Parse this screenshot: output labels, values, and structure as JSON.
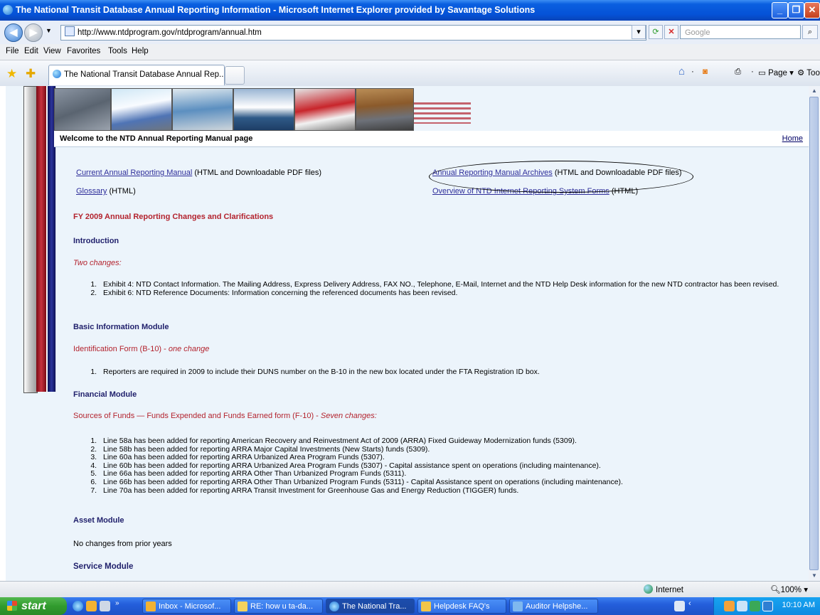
{
  "window": {
    "title": "The National Transit Database Annual Reporting Information - Microsoft Internet Explorer provided by Savantage Solutions"
  },
  "address_bar": {
    "url": "http://www.ntdprogram.gov/ntdprogram/annual.htm",
    "search_placeholder": "Google"
  },
  "menu": [
    "File",
    "Edit",
    "View",
    "Favorites",
    "Tools",
    "Help"
  ],
  "tabs": [
    {
      "label": "The National Transit Database Annual Rep..."
    }
  ],
  "command_bar": {
    "page_label": "Page",
    "tools_label": "Tools"
  },
  "page": {
    "welcome": "Welcome to the NTD Annual Reporting Manual page",
    "home_link": "Home",
    "links": {
      "current_manual": "Current Annual Reporting Manual",
      "current_manual_note": "(HTML and Downloadable PDF files)",
      "glossary": "Glossary",
      "glossary_note": "(HTML)",
      "archives": "Annual Reporting Manual Archives",
      "archives_note": "(HTML and Downloadable PDF files)",
      "overview": "Overview of NTD Internet Reporting System Forms",
      "overview_note": "(HTML)"
    },
    "fy_heading": "FY 2009 Annual Reporting Changes and Clarifications",
    "introduction": {
      "heading": "Introduction",
      "subheading": "Two changes:",
      "items": [
        "Exhibit 4: NTD Contact Information. The Mailing Address, Express Delivery Address, FAX NO., Telephone, E-Mail, Internet and the NTD Help Desk information for the new NTD contractor has been revised.",
        "Exhibit 6: NTD Reference Documents: Information concerning the referenced documents has been revised."
      ]
    },
    "basic_info": {
      "heading": "Basic Information Module",
      "subheading_main": "Identification Form (B-10) - ",
      "subheading_note": "one change",
      "items": [
        "Reporters are required in 2009 to include their DUNS number on the B-10 in the new box located under the FTA Registration ID box."
      ]
    },
    "financial": {
      "heading": "Financial Module",
      "subheading_main": "Sources of Funds — Funds Expended and Funds Earned form (F-10) - ",
      "subheading_note": "Seven changes:",
      "items": [
        "Line 58a has been added for reporting American Recovery and Reinvestment Act of 2009 (ARRA) Fixed Guideway Modernization funds (5309).",
        "Line 58b has been added for reporting ARRA Major Capital Investments (New Starts) funds (5309).",
        "Line 60a has been added for reporting ARRA Urbanized Area Program Funds (5307).",
        "Line 60b has been added for reporting ARRA Urbanized Area Program Funds (5307) - Capital assistance spent on operations (including maintenance).",
        "Line 66a has been added for reporting ARRA Other Than Urbanized Program Funds (5311).",
        "Line 66b has been added for reporting ARRA Other Than Urbanized Program Funds (5311) - Capital Assistance spent on operations (including maintenance).",
        "Line 70a has been added for reporting ARRA Transit Investment for Greenhouse Gas and Energy Reduction (TIGGER) funds."
      ]
    },
    "asset": {
      "heading": "Asset Module",
      "text": "No changes from prior years"
    },
    "service": {
      "heading": "Service Module"
    }
  },
  "status_bar": {
    "zone": "Internet",
    "zoom": "100%"
  },
  "taskbar": {
    "start": "start",
    "buttons": [
      {
        "label": "Inbox - Microsof...",
        "color": "#f2b233"
      },
      {
        "label": "RE: how u ta-da...",
        "color": "#f4d35e"
      },
      {
        "label": "The National Tra...",
        "color": "#3a9be8",
        "active": true
      },
      {
        "label": "Helpdesk FAQ's",
        "color": "#f3c64a"
      },
      {
        "label": "Auditor Helpshe...",
        "color": "#7fb8ef"
      }
    ],
    "clock": "10:10 AM"
  },
  "colors": {
    "accent": "#0552d7",
    "page_bg": "#ecf4fb",
    "heading": "#1f1f6b",
    "highlight_red": "#b3232e"
  }
}
